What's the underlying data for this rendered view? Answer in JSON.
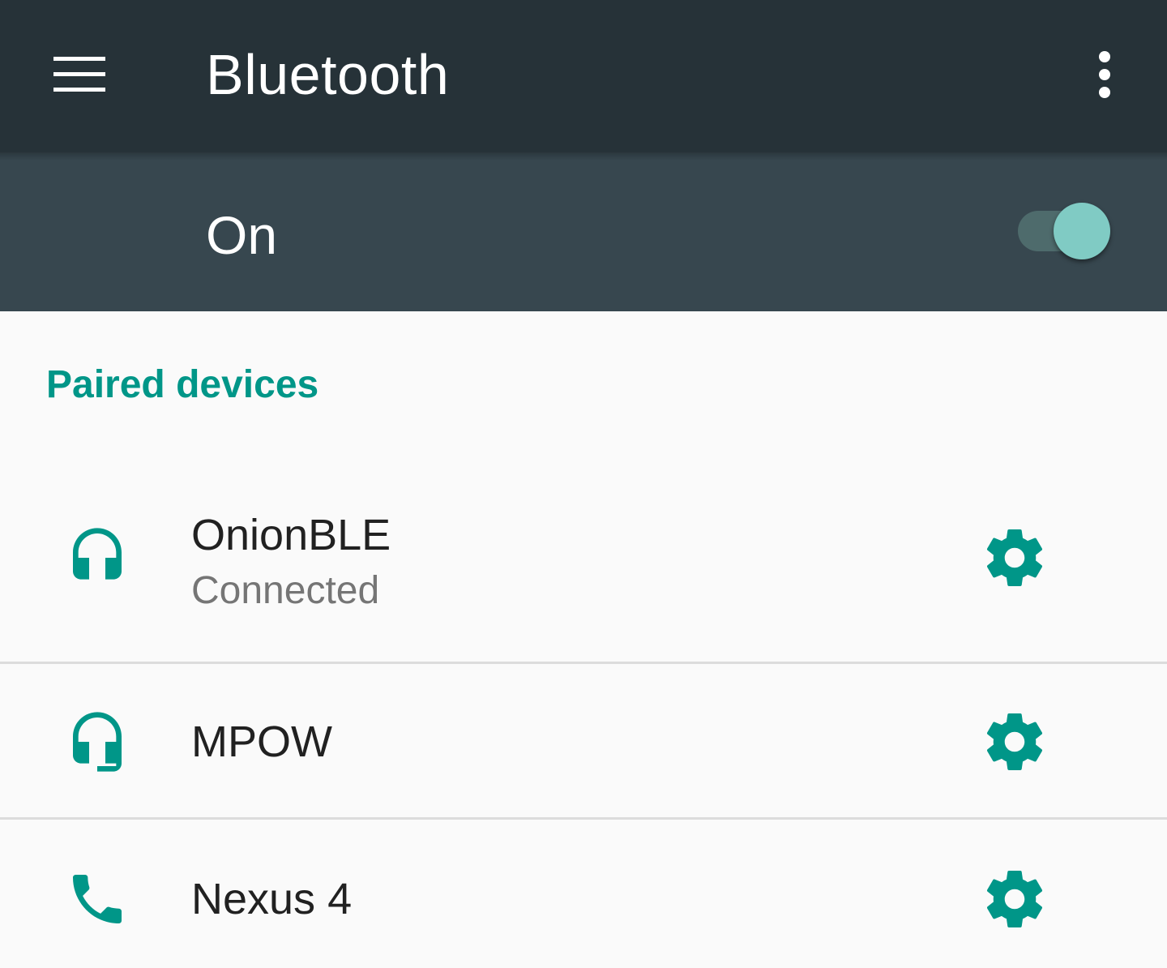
{
  "appbar": {
    "title": "Bluetooth",
    "menu_icon": "hamburger-menu-icon",
    "overflow_icon": "more-vert-icon",
    "background": "#263238"
  },
  "master_switch": {
    "label": "On",
    "checked": true,
    "background": "#37474f",
    "thumb_color": "#80cbc4"
  },
  "paired": {
    "header": "Paired devices",
    "accent": "#009688",
    "devices": [
      {
        "name": "OnionBLE",
        "status": "Connected",
        "icon": "headphones-icon",
        "settings_icon": "gear-icon"
      },
      {
        "name": "MPOW",
        "status": "",
        "icon": "headset-mic-icon",
        "settings_icon": "gear-icon"
      },
      {
        "name": "Nexus 4",
        "status": "",
        "icon": "phone-icon",
        "settings_icon": "gear-icon"
      }
    ]
  }
}
